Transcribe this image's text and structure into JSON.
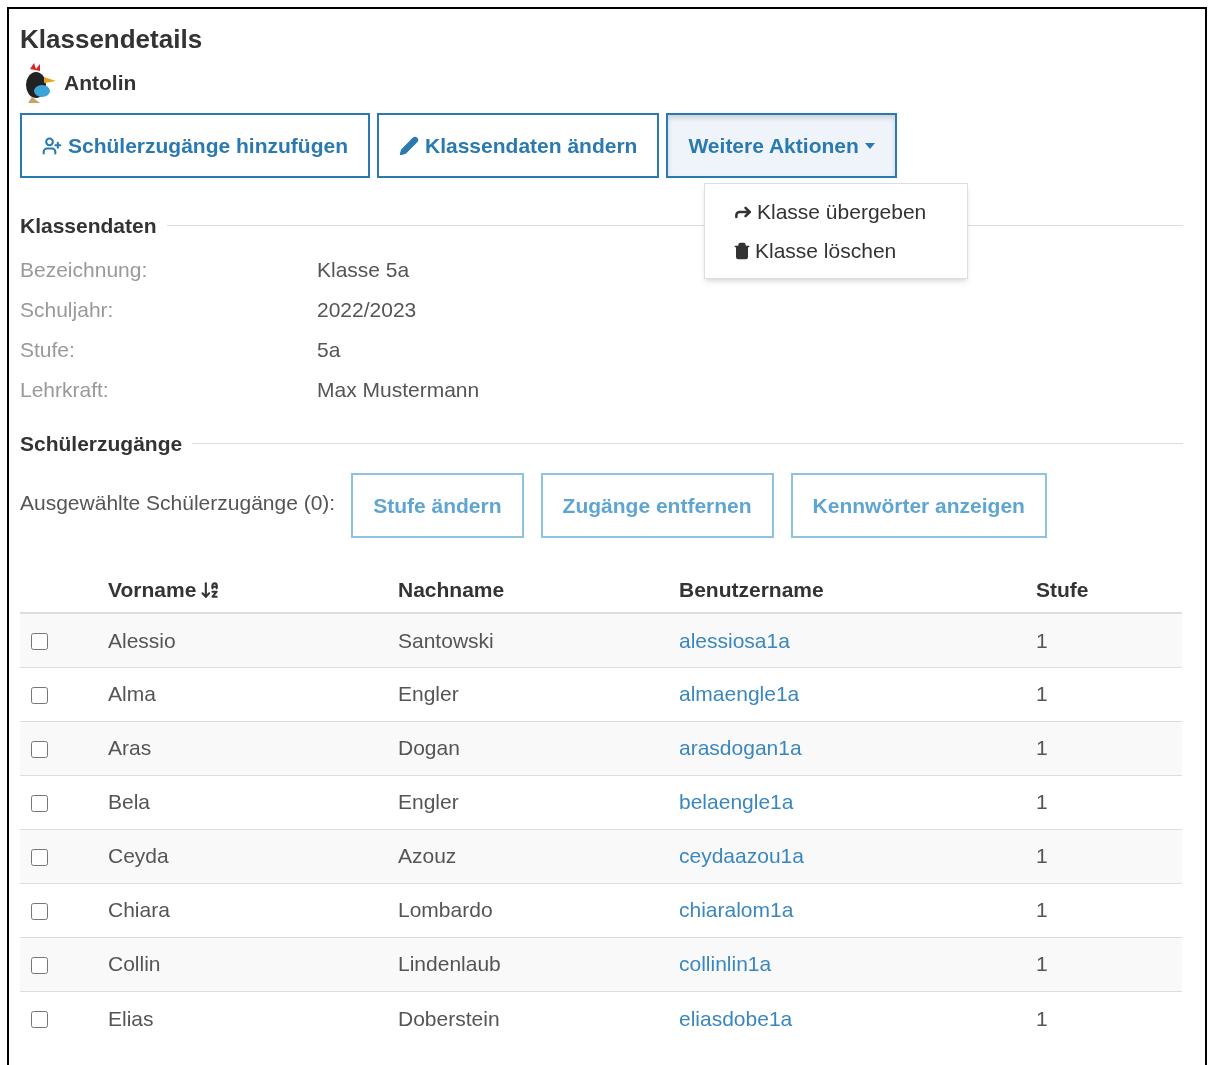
{
  "title": "Klassendetails",
  "product": {
    "name": "Antolin"
  },
  "actions": [
    {
      "kind": "add-student",
      "label": "Schülerzugänge hinzufügen"
    },
    {
      "kind": "edit",
      "label": "Klassendaten ändern"
    },
    {
      "kind": "dropdown",
      "label": "Weitere Aktionen",
      "expanded": true
    }
  ],
  "dropdown_menu": [
    {
      "kind": "share",
      "label": "Klasse übergeben"
    },
    {
      "kind": "delete",
      "label": "Klasse löschen"
    }
  ],
  "class_data": {
    "heading": "Klassendaten",
    "fields": [
      {
        "label": "Bezeichnung:",
        "value": "Klasse 5a"
      },
      {
        "label": "Schuljahr:",
        "value": "2022/2023"
      },
      {
        "label": "Stufe:",
        "value": "5a"
      },
      {
        "label": "Lehrkraft:",
        "value": "Max Mustermann"
      }
    ]
  },
  "students": {
    "heading": "Schülerzugänge",
    "selection_label": "Ausgewählte Schülerzugänge (0):",
    "bulk_actions": [
      {
        "label": "Stufe ändern",
        "disabled": true
      },
      {
        "label": "Zugänge entfernen",
        "disabled": true
      },
      {
        "label": "Kennwörter anzeigen",
        "disabled": true
      }
    ],
    "columns": [
      {
        "label": "Vorname",
        "sorted": true
      },
      {
        "label": "Nachname",
        "sorted": false
      },
      {
        "label": "Benutzername",
        "sorted": false
      },
      {
        "label": "Stufe",
        "sorted": false
      }
    ],
    "rows": [
      {
        "checked": false,
        "first": "Alessio",
        "last": "Santowski",
        "username": "alessiosa1a",
        "level": "1"
      },
      {
        "checked": false,
        "first": "Alma",
        "last": "Engler",
        "username": "almaengle1a",
        "level": "1"
      },
      {
        "checked": false,
        "first": "Aras",
        "last": "Dogan",
        "username": "arasdogan1a",
        "level": "1"
      },
      {
        "checked": false,
        "first": "Bela",
        "last": "Engler",
        "username": "belaengle1a",
        "level": "1"
      },
      {
        "checked": false,
        "first": "Ceyda",
        "last": "Azouz",
        "username": "ceydaazou1a",
        "level": "1"
      },
      {
        "checked": false,
        "first": "Chiara",
        "last": "Lombardo",
        "username": "chiaralom1a",
        "level": "1"
      },
      {
        "checked": false,
        "first": "Collin",
        "last": "Lindenlaub",
        "username": "collinlin1a",
        "level": "1"
      },
      {
        "checked": false,
        "first": "Elias",
        "last": "Doberstein",
        "username": "eliasdobe1a",
        "level": "1"
      }
    ]
  }
}
